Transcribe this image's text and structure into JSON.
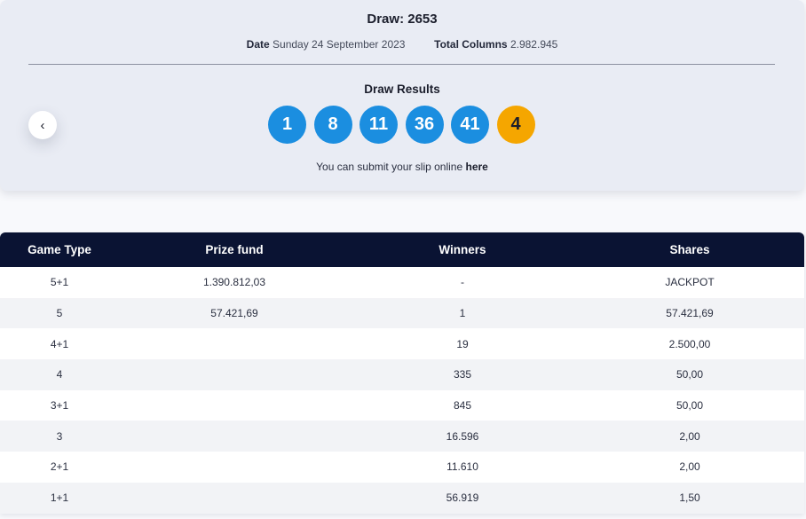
{
  "draw": {
    "title": "Draw: 2653",
    "date_label": "Date",
    "date_value": "Sunday 24 September 2023",
    "columns_label": "Total Columns",
    "columns_value": "2.982.945"
  },
  "results": {
    "title": "Draw Results",
    "numbers": [
      "1",
      "8",
      "11",
      "36",
      "41"
    ],
    "bonus": "4",
    "colors": {
      "main_ball": "#1b8ee0",
      "bonus_ball": "#f5a600",
      "header_bg": "#0a1333"
    },
    "submit_text": "You can submit your slip online ",
    "submit_link": "here"
  },
  "navigation": {
    "prev_icon": "chevron-left-icon",
    "prev_glyph": "‹"
  },
  "table": {
    "headers": [
      "Game Type",
      "Prize fund",
      "Winners",
      "Shares"
    ],
    "rows": [
      [
        "5+1",
        "1.390.812,03",
        "-",
        "JACKPOT"
      ],
      [
        "5",
        "57.421,69",
        "1",
        "57.421,69"
      ],
      [
        "4+1",
        "",
        "19",
        "2.500,00"
      ],
      [
        "4",
        "",
        "335",
        "50,00"
      ],
      [
        "3+1",
        "",
        "845",
        "50,00"
      ],
      [
        "3",
        "",
        "16.596",
        "2,00"
      ],
      [
        "2+1",
        "",
        "11.610",
        "2,00"
      ],
      [
        "1+1",
        "",
        "56.919",
        "1,50"
      ]
    ]
  }
}
